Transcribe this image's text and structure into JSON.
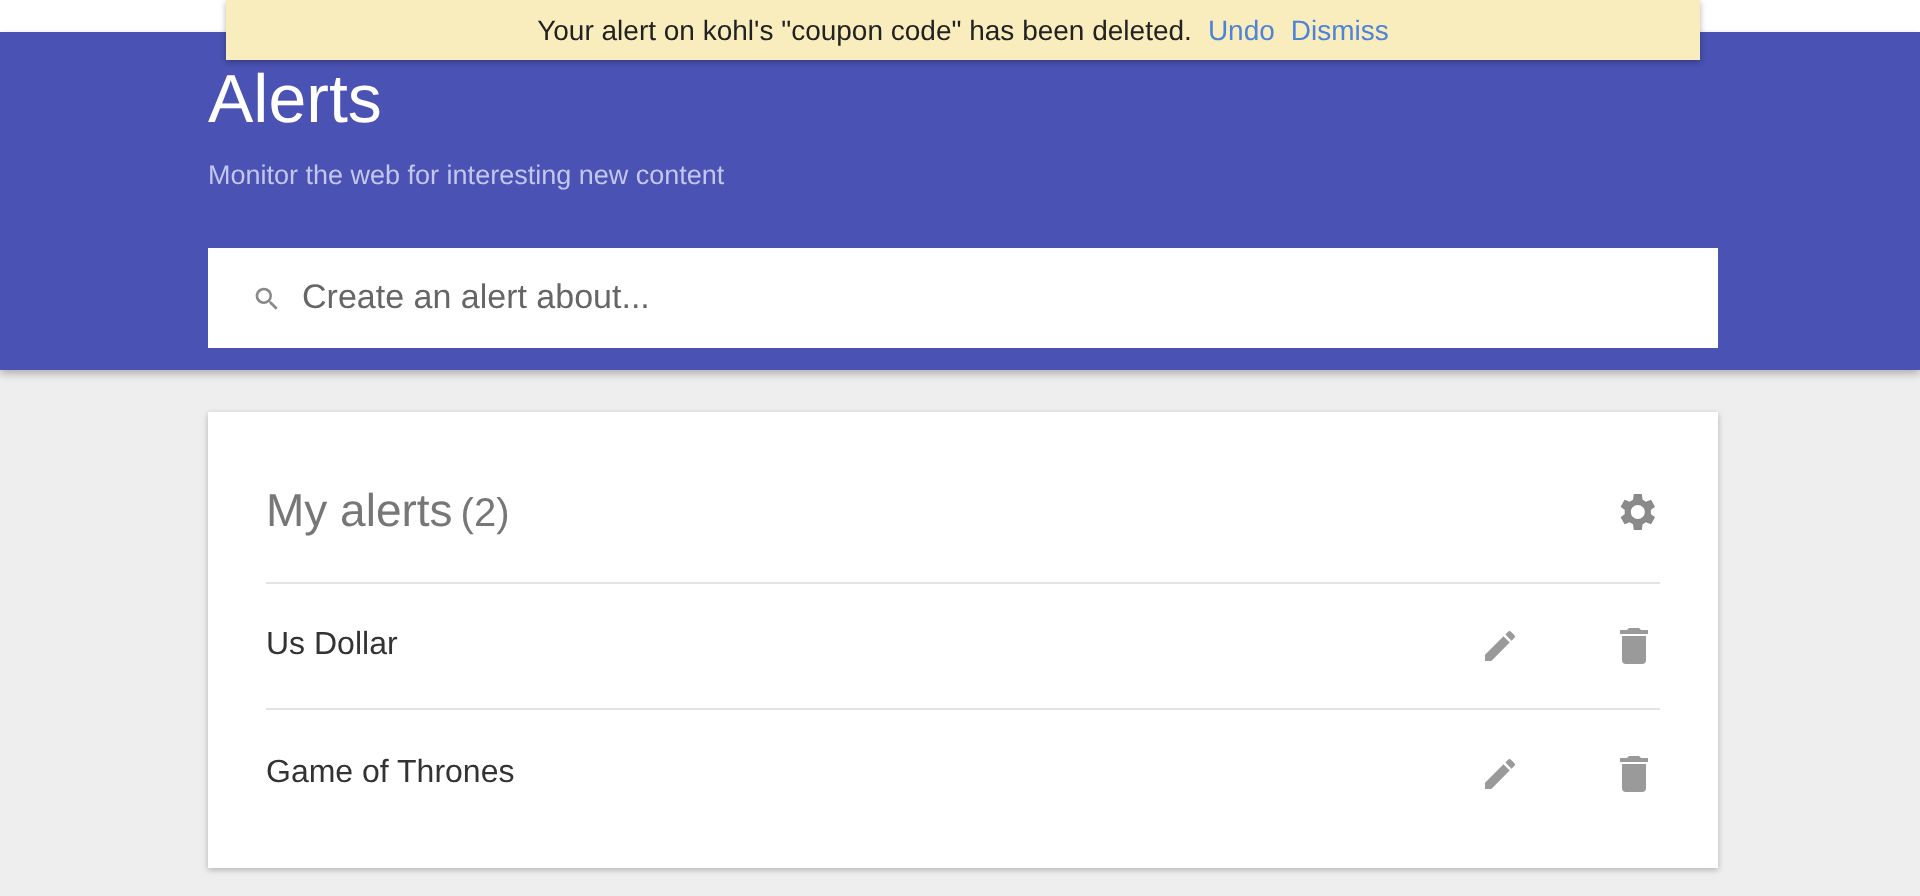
{
  "toast": {
    "message": "Your alert on kohl's \"coupon code\" has been deleted.",
    "actions": [
      "Undo",
      "Dismiss"
    ]
  },
  "header": {
    "title": "Alerts",
    "subtitle": "Monitor the web for interesting new content"
  },
  "search": {
    "placeholder": "Create an alert about..."
  },
  "alerts_card": {
    "title": "My alerts",
    "count": "(2)",
    "items": [
      {
        "name": "Us Dollar"
      },
      {
        "name": "Game of Thrones"
      }
    ]
  }
}
